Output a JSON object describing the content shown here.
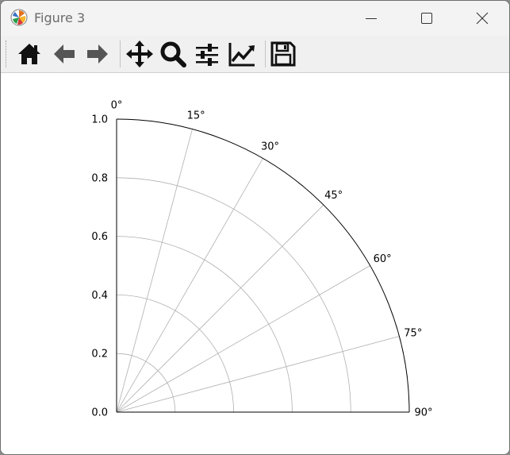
{
  "window": {
    "title": "Figure 3",
    "controls": {
      "minimize": "minimize",
      "maximize": "maximize",
      "close": "close"
    }
  },
  "toolbar": {
    "buttons": [
      {
        "name": "home",
        "icon": "home-icon"
      },
      {
        "name": "back",
        "icon": "arrow-left-icon"
      },
      {
        "name": "forward",
        "icon": "arrow-right-icon"
      },
      {
        "name": "pan",
        "icon": "move-icon"
      },
      {
        "name": "zoom",
        "icon": "magnifier-icon"
      },
      {
        "name": "configure-subplots",
        "icon": "sliders-icon"
      },
      {
        "name": "edit-axis",
        "icon": "line-chart-icon"
      },
      {
        "name": "save",
        "icon": "floppy-disk-icon"
      }
    ]
  },
  "chart_data": {
    "type": "polar",
    "title": "",
    "theta_range_deg": [
      0,
      90
    ],
    "theta_zero_location": "N",
    "theta_direction": "clockwise",
    "theta_ticks": [
      "0°",
      "15°",
      "30°",
      "45°",
      "60°",
      "75°",
      "90°"
    ],
    "theta_tick_values": [
      0,
      15,
      30,
      45,
      60,
      75,
      90
    ],
    "r_range": [
      0,
      1
    ],
    "r_ticks": [
      "0.0",
      "0.2",
      "0.4",
      "0.6",
      "0.8",
      "1.0"
    ],
    "r_tick_values": [
      0,
      0.2,
      0.4,
      0.6,
      0.8,
      1.0
    ],
    "grid": true,
    "series": []
  }
}
